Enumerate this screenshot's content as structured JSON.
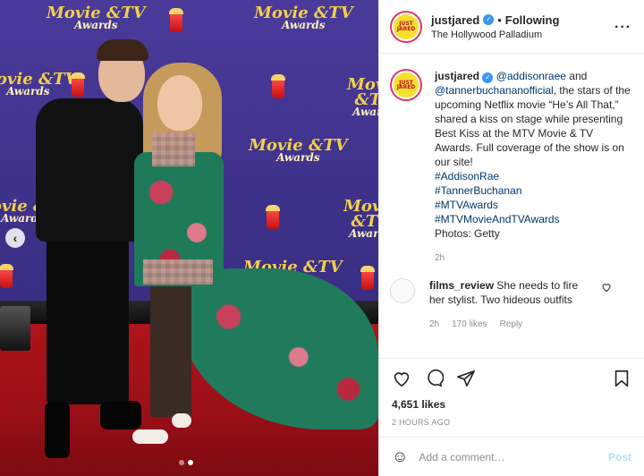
{
  "post": {
    "username": "justjared",
    "avatar_text": "JUST JARED",
    "follow_status": "Following",
    "location": "The Hollywood Palladium",
    "photo_logo_line1": "Movie &TV",
    "photo_logo_line2": "Awards",
    "carousel_prev": "‹"
  },
  "caption": {
    "username": "justjared",
    "mention1": "@addisonraee",
    "and_text": " and ",
    "mention2": "@tannerbuchananofficial",
    "body": ", the stars of the upcoming Netflix movie “He’s All That,” shared a kiss on stage while presenting Best Kiss at the MTV Movie & TV Awards. Full coverage of the show is on our site!",
    "hashtags": [
      "#AddisonRae",
      "#TannerBuchanan",
      "#MTVAwards",
      "#MTVMovieAndTVAwards"
    ],
    "credit": "Photos: Getty",
    "age": "2h"
  },
  "comment": {
    "username": "films_review",
    "text": "She needs to fire her stylist. Two hideous outfits",
    "age": "2h",
    "likes": "170 likes",
    "reply": "Reply"
  },
  "actions": {
    "likes": "4,651 likes",
    "time": "2 HOURS AGO"
  },
  "add_comment": {
    "placeholder": "Add a comment…",
    "post_label": "Post"
  },
  "colors": {
    "link": "#00376b",
    "verified": "#3897f0",
    "post_button": "#b2dffc",
    "story_ring": "#e5345f"
  }
}
